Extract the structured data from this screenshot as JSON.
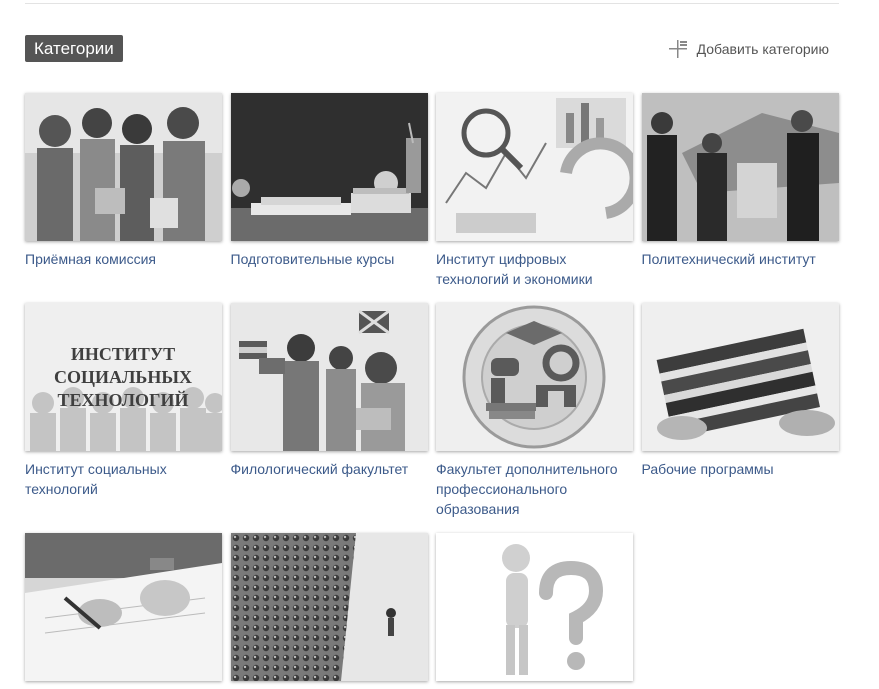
{
  "header": {
    "title": "Категории",
    "add_label": "Добавить категорию"
  },
  "categories": [
    {
      "label": "Приёмная комиссия",
      "icon": "students-photo"
    },
    {
      "label": "Подготовительные курсы",
      "icon": "chalkboard-photo"
    },
    {
      "label": "Институт цифровых технологий и экономики",
      "icon": "charts-photo"
    },
    {
      "label": "Политехнический институт",
      "icon": "business-people-photo"
    },
    {
      "label": "Институт социальных технологий",
      "icon": "institute-logo-image"
    },
    {
      "label": "Филологический факультет",
      "icon": "flags-students-photo"
    },
    {
      "label": "Факультет дополнительного профессионального образования",
      "icon": "faculty-seal-image"
    },
    {
      "label": "Рабочие программы",
      "icon": "binders-photo"
    },
    {
      "label": "",
      "icon": "writing-hand-photo"
    },
    {
      "label": "",
      "icon": "crowd-photo"
    },
    {
      "label": "",
      "icon": "question-figure-image"
    }
  ],
  "thumb_texts": {
    "institute_logo_lines": [
      "ИНСТИТУТ",
      "СОЦИАЛЬНЫХ",
      "ТЕХНОЛОГИЙ"
    ]
  }
}
